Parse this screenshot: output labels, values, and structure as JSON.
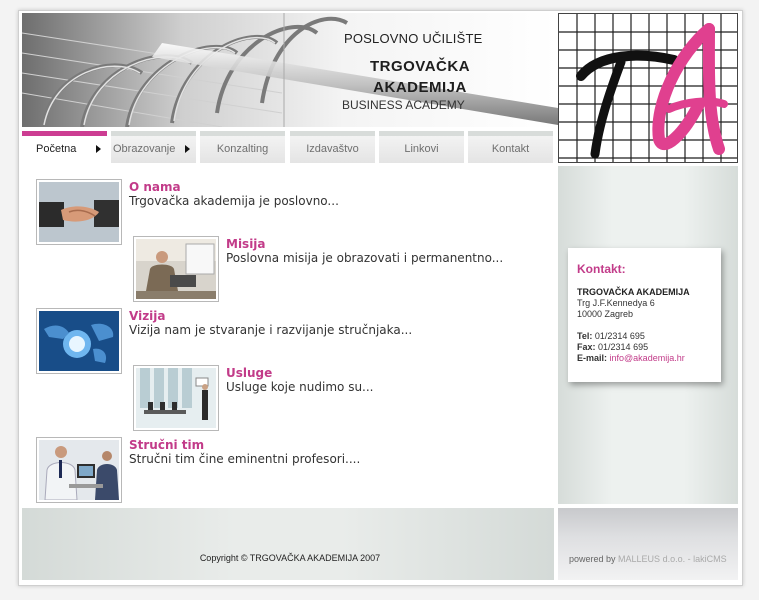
{
  "header": {
    "top_line": "POSLOVNO UČILIŠTE",
    "name_line1": "TRGOVAČKA",
    "name_line2": "AKADEMIJA",
    "sub_line": "BUSINESS ACADEMY"
  },
  "logo": {
    "text": "TA",
    "accent_color": "#e0408f"
  },
  "nav": [
    {
      "label": "Početna",
      "active": true,
      "has_arrow": true
    },
    {
      "label": "Obrazovanje",
      "active": false,
      "has_arrow": true
    },
    {
      "label": "Konzalting",
      "active": false,
      "has_arrow": false
    },
    {
      "label": "Izdavaštvo",
      "active": false,
      "has_arrow": false
    },
    {
      "label": "Linkovi",
      "active": false,
      "has_arrow": false
    },
    {
      "label": "Kontakt",
      "active": false,
      "has_arrow": false
    }
  ],
  "items": [
    {
      "title": "O nama",
      "desc": "Trgovačka akademija je poslovno...",
      "image": "handshake-photo"
    },
    {
      "title": "Misija",
      "desc": "Poslovna misija je obrazovati i permanentno...",
      "image": "businessman-office-photo"
    },
    {
      "title": "Vizija",
      "desc": "Vizija nam je stvaranje i razvijanje stručnjaka...",
      "image": "globe-map-photo"
    },
    {
      "title": "Usluge",
      "desc": "Usluge koje nudimo su...",
      "image": "meeting-room-photo"
    },
    {
      "title": "Stručni tim",
      "desc": "Stručni tim čine eminentni profesori....",
      "image": "team-computer-photo"
    }
  ],
  "contact": {
    "title": "Kontakt:",
    "org": "TRGOVAČKA AKADEMIJA",
    "street": "Trg J.F.Kennedya 6",
    "city": "10000 Zagreb",
    "tel_label": "Tel:",
    "tel": "01/2314 695",
    "fax_label": "Fax:",
    "fax": "01/2314 695",
    "email_label": "E-mail:",
    "email": "info@akademija.hr"
  },
  "footer": {
    "copyright": "Copyright © TRGOVAČKA AKADEMIJA 2007",
    "powered_prefix": "powered by",
    "powered_company": "MALLEUS d.o.o. - lakiCMS"
  },
  "colors": {
    "accent": "#c23b89",
    "panel": "#e5eae7"
  }
}
